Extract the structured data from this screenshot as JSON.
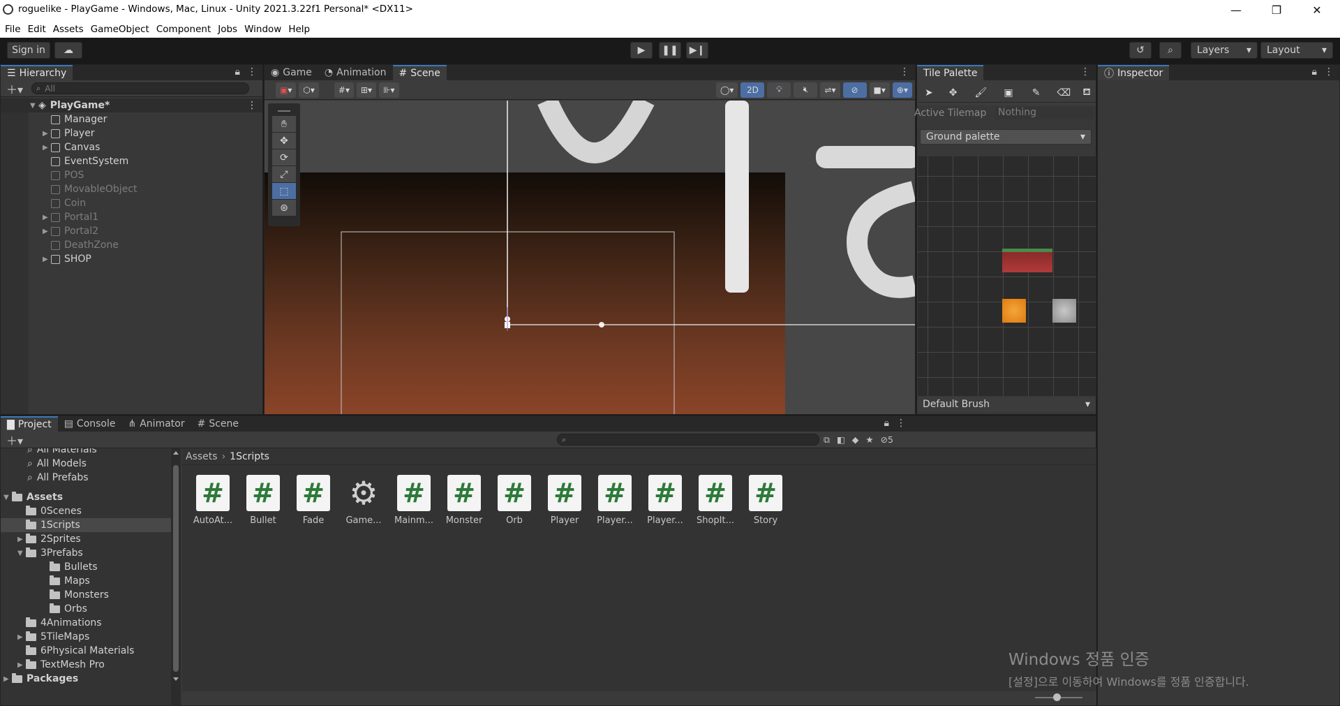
{
  "window": {
    "title": "roguelike - PlayGame - Windows, Mac, Linux - Unity 2021.3.22f1 Personal* <DX11>",
    "minimize": "—",
    "maximize": "❐",
    "close": "✕"
  },
  "menu": [
    "File",
    "Edit",
    "Assets",
    "GameObject",
    "Component",
    "Jobs",
    "Window",
    "Help"
  ],
  "toolbar": {
    "sign_in": "Sign in",
    "layers": "Layers",
    "layout": "Layout"
  },
  "hierarchy": {
    "tab": "Hierarchy",
    "search_placeholder": "All",
    "scene": "PlayGame*",
    "items": [
      {
        "label": "Manager",
        "expandable": false,
        "active": true
      },
      {
        "label": "Player",
        "expandable": true,
        "active": true
      },
      {
        "label": "Canvas",
        "expandable": true,
        "active": true
      },
      {
        "label": "EventSystem",
        "expandable": false,
        "active": true
      },
      {
        "label": "POS",
        "expandable": false,
        "active": false
      },
      {
        "label": "MovableObject",
        "expandable": false,
        "active": false
      },
      {
        "label": "Coin",
        "expandable": false,
        "active": false
      },
      {
        "label": "Portal1",
        "expandable": true,
        "active": false
      },
      {
        "label": "Portal2",
        "expandable": true,
        "active": false
      },
      {
        "label": "DeathZone",
        "expandable": false,
        "active": false
      },
      {
        "label": "SHOP",
        "expandable": true,
        "active": true
      }
    ]
  },
  "scene_view": {
    "tabs": [
      "Game",
      "Animation",
      "Scene"
    ],
    "mode_2d": "2D"
  },
  "tile_palette": {
    "tab": "Tile Palette",
    "active_tilemap_label": "Active Tilemap",
    "active_tilemap_value": "Nothing",
    "palette": "Ground palette",
    "brush": "Default Brush"
  },
  "inspector": {
    "tab": "Inspector"
  },
  "bottom": {
    "tabs": [
      "Project",
      "Console",
      "Animator",
      "Scene"
    ],
    "hidden_count": "5",
    "favorites": [
      "All Materials",
      "All Models",
      "All Prefabs"
    ],
    "assets_root": "Assets",
    "tree": [
      {
        "label": "0Scenes",
        "indent": 1,
        "expandable": false,
        "selected": false
      },
      {
        "label": "1Scripts",
        "indent": 1,
        "expandable": false,
        "selected": true
      },
      {
        "label": "2Sprites",
        "indent": 1,
        "expandable": true,
        "selected": false
      },
      {
        "label": "3Prefabs",
        "indent": 1,
        "expandable": true,
        "open": true,
        "selected": false
      },
      {
        "label": "Bullets",
        "indent": 2,
        "expandable": false,
        "selected": false
      },
      {
        "label": "Maps",
        "indent": 2,
        "expandable": false,
        "selected": false
      },
      {
        "label": "Monsters",
        "indent": 2,
        "expandable": false,
        "selected": false
      },
      {
        "label": "Orbs",
        "indent": 2,
        "expandable": false,
        "selected": false
      },
      {
        "label": "4Animations",
        "indent": 1,
        "expandable": false,
        "selected": false
      },
      {
        "label": "5TileMaps",
        "indent": 1,
        "expandable": true,
        "selected": false
      },
      {
        "label": "6Physical Materials",
        "indent": 1,
        "expandable": false,
        "selected": false
      },
      {
        "label": "TextMesh Pro",
        "indent": 1,
        "expandable": true,
        "selected": false
      }
    ],
    "packages": "Packages",
    "breadcrumb": [
      "Assets",
      "1Scripts"
    ],
    "assets": [
      {
        "label": "AutoAt...",
        "kind": "script"
      },
      {
        "label": "Bullet",
        "kind": "script"
      },
      {
        "label": "Fade",
        "kind": "script"
      },
      {
        "label": "Game...",
        "kind": "gear"
      },
      {
        "label": "Mainm...",
        "kind": "script"
      },
      {
        "label": "Monster",
        "kind": "script"
      },
      {
        "label": "Orb",
        "kind": "script"
      },
      {
        "label": "Player",
        "kind": "script"
      },
      {
        "label": "Player...",
        "kind": "script"
      },
      {
        "label": "Player...",
        "kind": "script"
      },
      {
        "label": "ShopIt...",
        "kind": "script"
      },
      {
        "label": "Story",
        "kind": "script"
      }
    ]
  },
  "watermark": {
    "line1": "Windows 정품 인증",
    "line2": "[설정]으로 이동하여 Windows를 정품 인증합니다."
  }
}
